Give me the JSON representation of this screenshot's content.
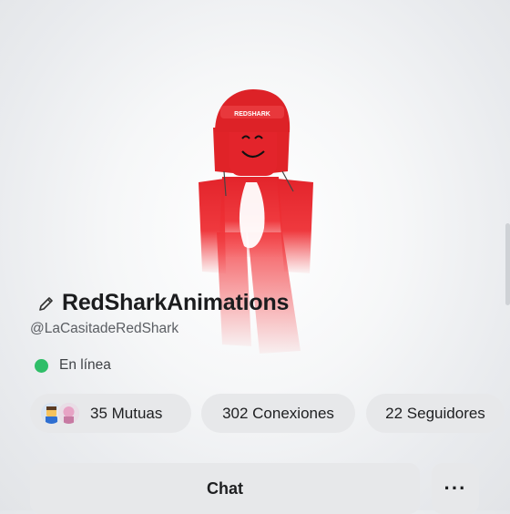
{
  "profile": {
    "display_name": "RedSharkAnimations",
    "username": "@LaCasitadeRedShark",
    "status": "En línea",
    "status_color": "#2fbe68",
    "avatar_color": "#e3242b",
    "hat_text": "REDSHARK"
  },
  "stats": {
    "mutuals": "35 Mutuas",
    "connections": "302 Conexiones",
    "followers": "22 Seguidores"
  },
  "actions": {
    "chat": "Chat",
    "more": "···"
  },
  "icons": {
    "edit": "pencil-icon"
  }
}
